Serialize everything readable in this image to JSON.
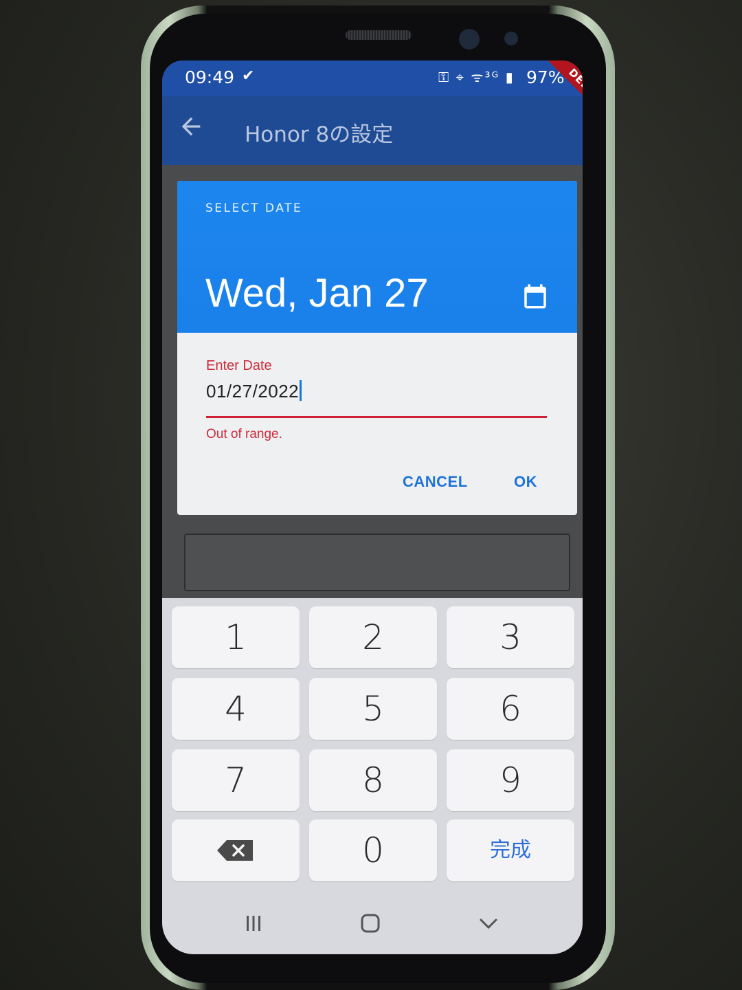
{
  "status_bar": {
    "time": "09:49",
    "check_glyph": "✔",
    "system_icons": "⚿ ⌖ ᯤ³ᴳ ▮",
    "battery": "97%",
    "debug_banner": "DEBUG"
  },
  "app_bar": {
    "title": "Honor 8の設定"
  },
  "date_picker": {
    "help_text": "SELECT DATE",
    "headline": "Wed, Jan 27",
    "field": {
      "label": "Enter Date",
      "value": "01/27/2022",
      "error": "Out of range."
    },
    "cancel_label": "CANCEL",
    "ok_label": "OK"
  },
  "keyboard": {
    "keys": [
      "1",
      "2",
      "3",
      "4",
      "5",
      "6",
      "7",
      "8",
      "9",
      "0"
    ],
    "done_label": "完成"
  },
  "colors": {
    "header_blue": "#1d86ee",
    "error_red": "#d11f36",
    "accent_blue": "#1f73d8",
    "app_bar": "#1e4b94"
  },
  "icons": {
    "back": "arrow-left-icon",
    "calendar": "calendar-icon",
    "backspace": "backspace-icon",
    "nav_recents": "recents-icon",
    "nav_home": "home-icon",
    "nav_back": "chevron-down-icon"
  }
}
